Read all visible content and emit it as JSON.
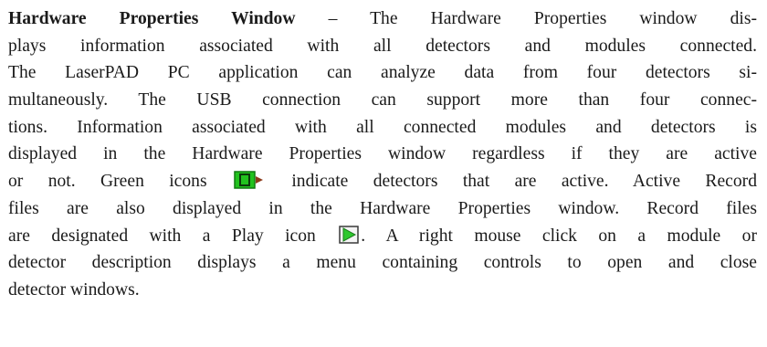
{
  "section": {
    "heading": "Hardware Properties Window",
    "lines": [
      {
        "text": "– The Hardware Properties window dis-"
      },
      {
        "text": "plays information associated with all detectors and modules connected."
      },
      {
        "text": "The LaserPAD PC application can analyze data from four detectors si-"
      },
      {
        "text": "multaneously. The USB connection can support more than four connec-"
      },
      {
        "text": "tions. Information associated with all connected modules and detectors is"
      },
      {
        "text": "displayed in the Hardware Properties window regardless if they are active"
      },
      {
        "before": "or not. Green icons",
        "after": "indicate detectors that are active. Active Record"
      },
      {
        "text": "files are also displayed in the Hardware Properties window. Record files"
      },
      {
        "before": "are designated with a Play icon",
        "after": ". A right mouse click on a module or"
      },
      {
        "text": "detector description displays a menu containing controls to open and close"
      },
      {
        "text": "detector windows."
      }
    ]
  },
  "icons": {
    "detector_active": {
      "name": "active-detector-icon",
      "color": "#22c21e",
      "arrow_color": "#8c3a1a"
    },
    "play": {
      "name": "play-icon",
      "color": "#2ec82e",
      "border_color": "#3a3a3a"
    }
  }
}
